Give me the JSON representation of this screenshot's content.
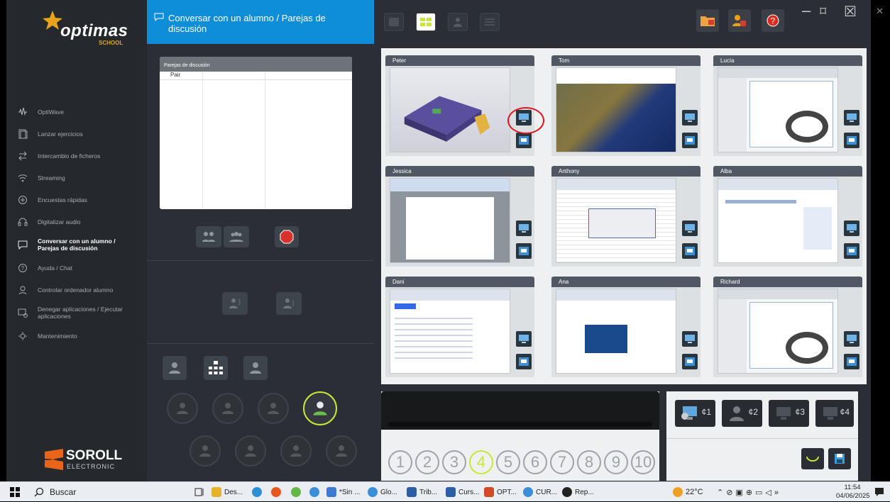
{
  "brand": {
    "name": "optimas",
    "sub": "SCHOOL"
  },
  "footer_brand": {
    "name": "SOROLL",
    "sub": "ELECTRONIC"
  },
  "nav": {
    "items": [
      {
        "label": "OptiWave",
        "icon": "wave-icon"
      },
      {
        "label": "Lanzar ejercicios",
        "icon": "document-icon"
      },
      {
        "label": "Intercambio de ficheros",
        "icon": "exchange-icon"
      },
      {
        "label": "Streaming",
        "icon": "wifi-icon"
      },
      {
        "label": "Encuestas rápidas",
        "icon": "survey-icon"
      },
      {
        "label": "Digitalizar audio",
        "icon": "headset-icon"
      },
      {
        "label": "Conversar con un alumno / Parejas de discusión",
        "icon": "chat-icon",
        "active": true
      },
      {
        "label": "Ayuda / Chat",
        "icon": "help-icon"
      },
      {
        "label": "Controlar ordenador alumno",
        "icon": "control-icon"
      },
      {
        "label": "Denegar aplicaciones / Ejecutar aplicaciones",
        "icon": "deny-apps-icon"
      },
      {
        "label": "Mantenimiento",
        "icon": "maintenance-icon"
      }
    ]
  },
  "mid": {
    "title": "Conversar con un alumno / Parejas de discusión",
    "pairs_header": "Parejas de discusión",
    "pairs_row": "Pair"
  },
  "students": [
    {
      "name": "Peter",
      "screen": "3d-model"
    },
    {
      "name": "Tom",
      "screen": "google-maps"
    },
    {
      "name": "Lucía",
      "screen": "web-shop"
    },
    {
      "name": "Jessica",
      "screen": "word-doc"
    },
    {
      "name": "Anthony",
      "screen": "spreadsheet-dialog"
    },
    {
      "name": "Alba",
      "screen": "gmail"
    },
    {
      "name": "Dani",
      "screen": "google-search"
    },
    {
      "name": "Ana",
      "screen": "web-page"
    },
    {
      "name": "Richard",
      "screen": "web-shop"
    }
  ],
  "pages": [
    "1",
    "2",
    "3",
    "4",
    "5",
    "6",
    "7",
    "8",
    "9",
    "10"
  ],
  "selected_page": "4",
  "monitors": [
    "¢1",
    "¢2",
    "¢3",
    "¢4"
  ],
  "taskbar": {
    "search": "Buscar",
    "apps": [
      "Des...",
      "*Sin ...",
      "Glo...",
      "Trib...",
      "Curs...",
      "OPT...",
      "CUR...",
      "Rep..."
    ],
    "temp": "22°C",
    "time": "11:54",
    "date": "04/06/2025"
  },
  "colors": {
    "accent": "#0e8ed6",
    "highlight": "#c9e63b",
    "sidebar": "#25282d",
    "tile_header": "#505963",
    "annotation": "#e0141e"
  }
}
